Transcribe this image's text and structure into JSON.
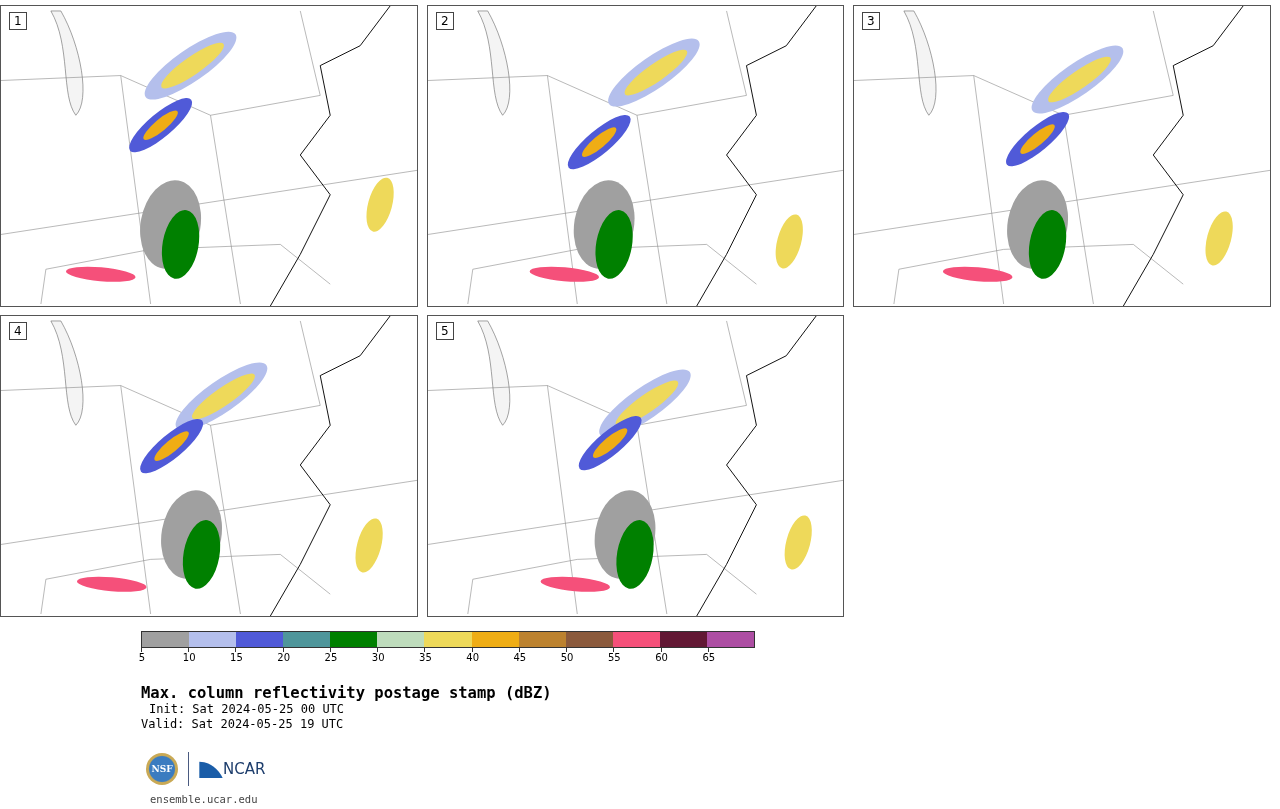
{
  "panels": [
    {
      "label": "1"
    },
    {
      "label": "2"
    },
    {
      "label": "3"
    },
    {
      "label": "4"
    },
    {
      "label": "5"
    }
  ],
  "colorbar": {
    "segments": [
      {
        "color": "#a0a0a0"
      },
      {
        "color": "#b4bfec"
      },
      {
        "color": "#505ad8"
      },
      {
        "color": "#4f969b"
      },
      {
        "color": "#008000"
      },
      {
        "color": "#bedcbc"
      },
      {
        "color": "#eed95a"
      },
      {
        "color": "#efad15"
      },
      {
        "color": "#bc822f"
      },
      {
        "color": "#8b5a3c"
      },
      {
        "color": "#f5507a"
      },
      {
        "color": "#621834"
      },
      {
        "color": "#ad4ea3"
      }
    ],
    "ticks": [
      "5",
      "10",
      "15",
      "20",
      "25",
      "30",
      "35",
      "40",
      "45",
      "50",
      "55",
      "60",
      "65"
    ]
  },
  "title": "Max. column reflectivity postage stamp (dBZ)",
  "init": "Init: Sat 2024-05-25 00 UTC",
  "valid": "Valid: Sat 2024-05-25 19 UTC",
  "logo": {
    "seal": "NSF",
    "word": "NCAR"
  },
  "site": "ensemble.ucar.edu"
}
